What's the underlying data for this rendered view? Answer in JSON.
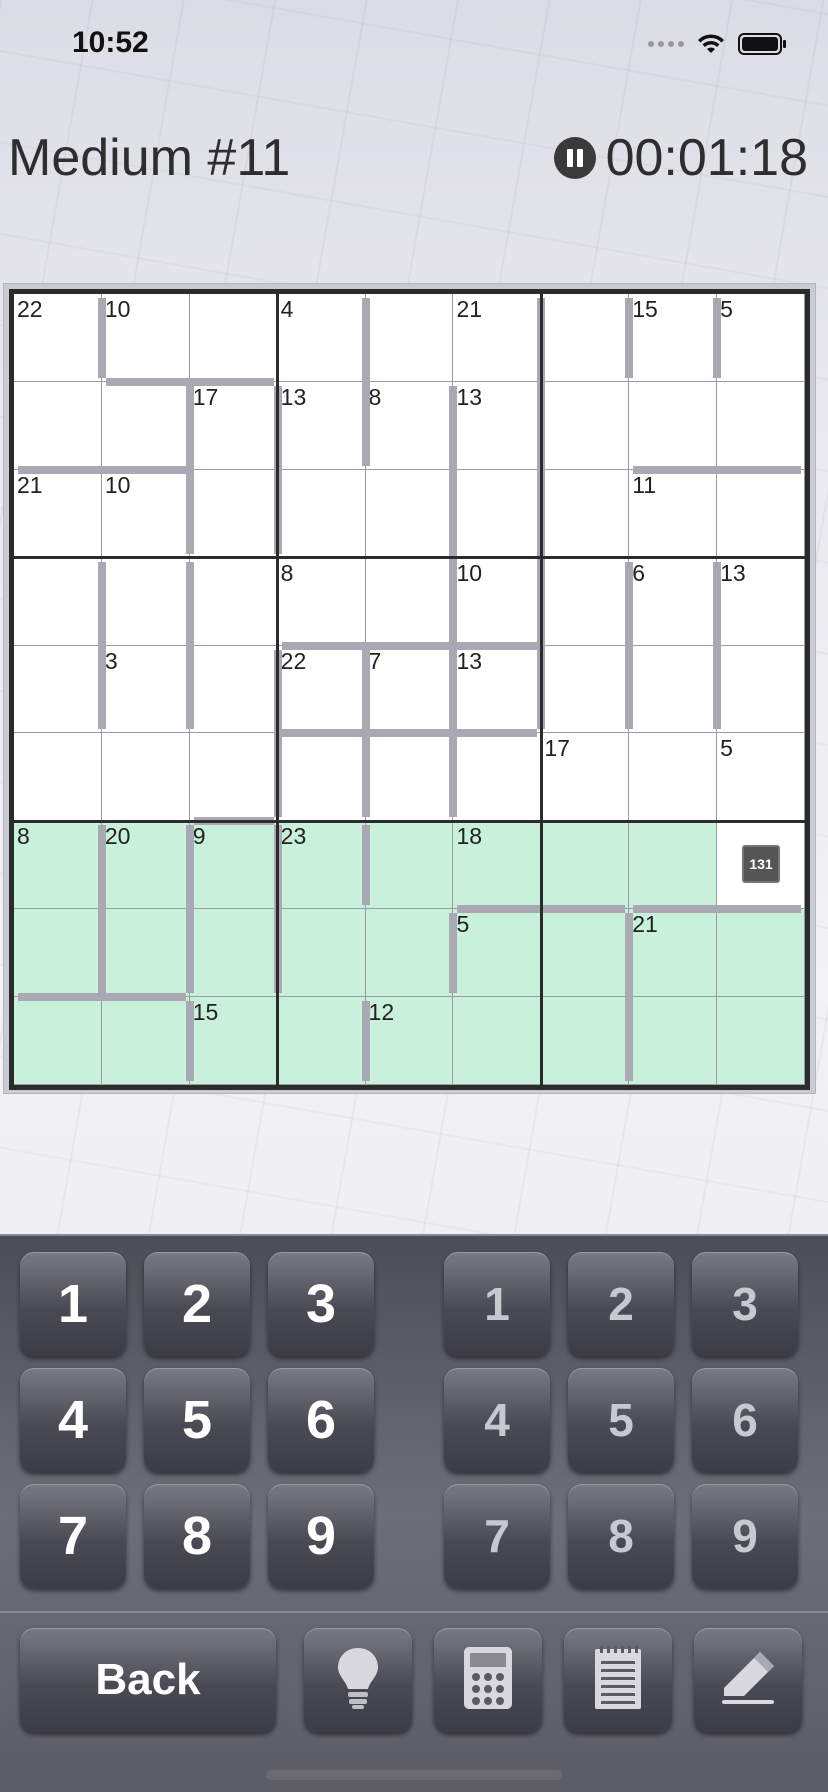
{
  "status_bar": {
    "time": "10:52",
    "icons": [
      "cellular-signal-icon",
      "wifi-icon",
      "battery-icon"
    ]
  },
  "header": {
    "title": "Medium #11",
    "timer": "00:01:18",
    "pause_icon": "pause-icon"
  },
  "board": {
    "size": 9,
    "highlight_color": "#c8f0da",
    "highlighted_rows": [
      6,
      7,
      8
    ],
    "total_badge": "131",
    "cage_sums": [
      {
        "row": 0,
        "col": 0,
        "sum": "22"
      },
      {
        "row": 0,
        "col": 1,
        "sum": "10"
      },
      {
        "row": 0,
        "col": 3,
        "sum": "4"
      },
      {
        "row": 0,
        "col": 5,
        "sum": "21"
      },
      {
        "row": 0,
        "col": 7,
        "sum": "15"
      },
      {
        "row": 0,
        "col": 8,
        "sum": "5"
      },
      {
        "row": 1,
        "col": 2,
        "sum": "17"
      },
      {
        "row": 1,
        "col": 3,
        "sum": "13"
      },
      {
        "row": 1,
        "col": 4,
        "sum": "8"
      },
      {
        "row": 1,
        "col": 5,
        "sum": "13"
      },
      {
        "row": 2,
        "col": 0,
        "sum": "21"
      },
      {
        "row": 2,
        "col": 1,
        "sum": "10"
      },
      {
        "row": 2,
        "col": 7,
        "sum": "11"
      },
      {
        "row": 3,
        "col": 3,
        "sum": "8"
      },
      {
        "row": 3,
        "col": 5,
        "sum": "10"
      },
      {
        "row": 3,
        "col": 7,
        "sum": "6"
      },
      {
        "row": 3,
        "col": 8,
        "sum": "13"
      },
      {
        "row": 4,
        "col": 1,
        "sum": "3"
      },
      {
        "row": 4,
        "col": 3,
        "sum": "22"
      },
      {
        "row": 4,
        "col": 4,
        "sum": "7"
      },
      {
        "row": 4,
        "col": 5,
        "sum": "13"
      },
      {
        "row": 5,
        "col": 6,
        "sum": "17"
      },
      {
        "row": 5,
        "col": 8,
        "sum": "5"
      },
      {
        "row": 6,
        "col": 0,
        "sum": "8"
      },
      {
        "row": 6,
        "col": 1,
        "sum": "20"
      },
      {
        "row": 6,
        "col": 2,
        "sum": "9"
      },
      {
        "row": 6,
        "col": 3,
        "sum": "23"
      },
      {
        "row": 6,
        "col": 5,
        "sum": "18"
      },
      {
        "row": 7,
        "col": 5,
        "sum": "5"
      },
      {
        "row": 7,
        "col": 7,
        "sum": "21"
      },
      {
        "row": 8,
        "col": 2,
        "sum": "15"
      },
      {
        "row": 8,
        "col": 4,
        "sum": "12"
      }
    ]
  },
  "keypad": {
    "digits": [
      "1",
      "2",
      "3",
      "4",
      "5",
      "6",
      "7",
      "8",
      "9"
    ],
    "note_digits": [
      "1",
      "2",
      "3",
      "4",
      "5",
      "6",
      "7",
      "8",
      "9"
    ],
    "back_label": "Back",
    "tools": [
      "lightbulb-icon",
      "calculator-icon",
      "notepad-icon",
      "eraser-icon"
    ]
  }
}
